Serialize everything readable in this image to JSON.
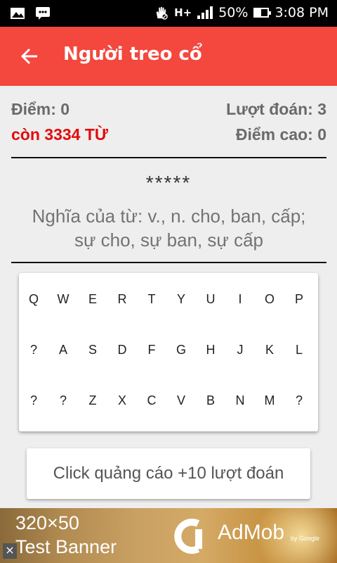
{
  "status_bar": {
    "battery_percent": "50%",
    "time": "3:08 PM",
    "network_type": "H+",
    "battery_level": 0.5
  },
  "app_bar": {
    "title": "Người treo cổ"
  },
  "stats": {
    "score_label": "Điểm: 0",
    "remaining_words": "còn 3334 TỪ",
    "guesses_label": "Lượt đoán: 3",
    "high_score_label": "Điểm cao: 0"
  },
  "puzzle": {
    "masked_word": "*****",
    "meaning_line1": "Nghĩa của từ: v., n.  cho, ban, cấp;",
    "meaning_line2": "sự cho, sự ban, sự cấp"
  },
  "keyboard": {
    "rows": [
      [
        "Q",
        "W",
        "E",
        "R",
        "T",
        "Y",
        "U",
        "I",
        "O",
        "P"
      ],
      [
        "?",
        "A",
        "S",
        "D",
        "F",
        "G",
        "H",
        "J",
        "K",
        "L"
      ],
      [
        "?",
        "?",
        "Z",
        "X",
        "C",
        "V",
        "B",
        "N",
        "M",
        "?"
      ]
    ]
  },
  "reward_button": {
    "label": "Click quảng cáo +10 lượt đoán"
  },
  "banner": {
    "line1": "320×50",
    "line2": "Test Banner",
    "brand": "AdMob",
    "by": "by Google",
    "close": "×"
  },
  "colors": {
    "accent": "#f4473e",
    "remaining_text": "#e30b0b"
  }
}
